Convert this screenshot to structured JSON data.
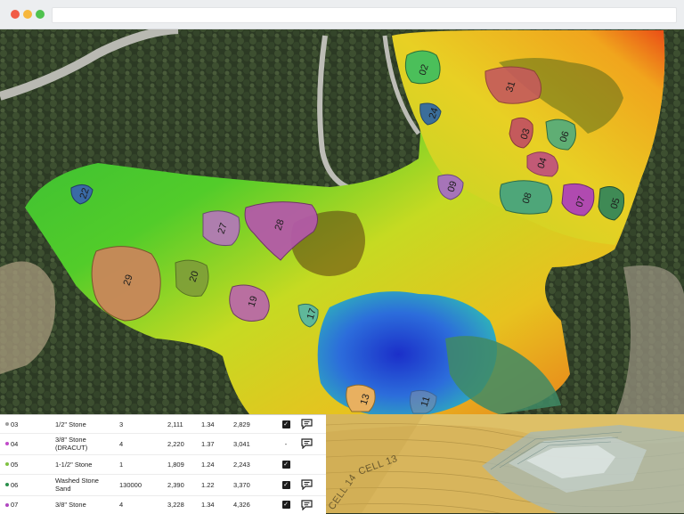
{
  "browser": {
    "window_controls": [
      "close",
      "minimize",
      "maximize"
    ]
  },
  "map": {
    "zones": [
      {
        "id": "02"
      },
      {
        "id": "31"
      },
      {
        "id": "24"
      },
      {
        "id": "03"
      },
      {
        "id": "06"
      },
      {
        "id": "04"
      },
      {
        "id": "09"
      },
      {
        "id": "08"
      },
      {
        "id": "07"
      },
      {
        "id": "05"
      },
      {
        "id": "22"
      },
      {
        "id": "27"
      },
      {
        "id": "28"
      },
      {
        "id": "29"
      },
      {
        "id": "20"
      },
      {
        "id": "19"
      },
      {
        "id": "17"
      },
      {
        "id": "13"
      },
      {
        "id": "11"
      }
    ]
  },
  "table": {
    "rows": [
      {
        "id": "03",
        "material": "1/2\" Stone",
        "qty": "3",
        "volume": "2,111",
        "ratio": "1.34",
        "tons": "2,829",
        "check": true,
        "dot": "#9e9e9e"
      },
      {
        "id": "04",
        "material": "3/8\" Stone (DRACUT)",
        "qty": "4",
        "volume": "2,220",
        "ratio": "1.37",
        "tons": "3,041",
        "check": false,
        "check_text": "-",
        "dot": "#c24bc9"
      },
      {
        "id": "05",
        "material": "1-1/2\" Stone",
        "qty": "1",
        "volume": "1,809",
        "ratio": "1.24",
        "tons": "2,243",
        "check": true,
        "dot": "#7fc241"
      },
      {
        "id": "06",
        "material": "Washed Stone Sand",
        "qty": "130000",
        "volume": "2,390",
        "ratio": "1.22",
        "tons": "3,370",
        "check": true,
        "dot": "#2a8f4c"
      },
      {
        "id": "07",
        "material": "3/8\" Stone",
        "qty": "4",
        "volume": "3,228",
        "ratio": "1.34",
        "tons": "4,326",
        "check": true,
        "dot": "#b047c0"
      }
    ]
  },
  "cad": {
    "labels": [
      "CELL 13",
      "CELL 14"
    ]
  }
}
